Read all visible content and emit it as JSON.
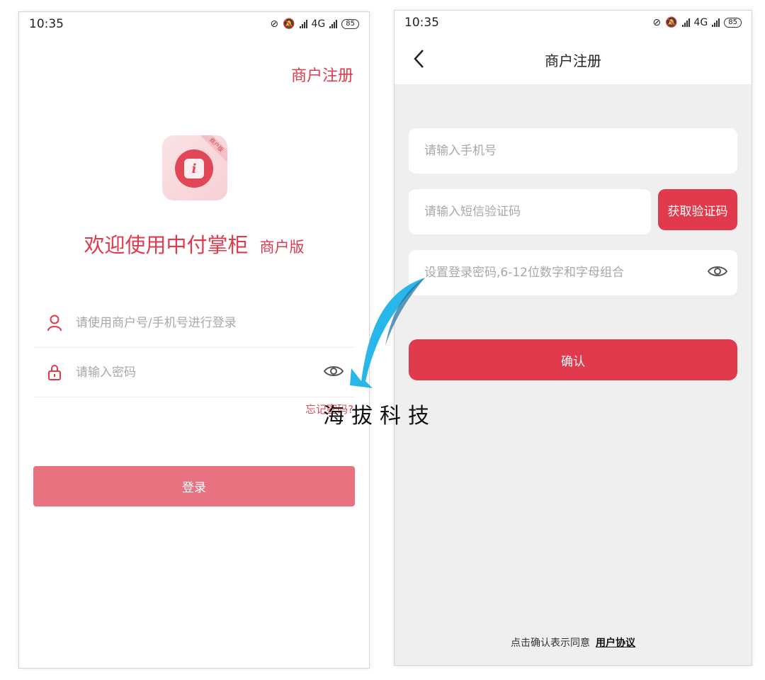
{
  "left_screen": {
    "status": {
      "time": "10:35",
      "network": "4G",
      "battery": "85"
    },
    "register_link": "商户注册",
    "logo": {
      "ribbon": "商户版",
      "glyph": "i"
    },
    "welcome_main": "欢迎使用中付掌柜",
    "welcome_sub": "商户版",
    "username_placeholder": "请使用商户号/手机号进行登录",
    "password_placeholder": "请输入密码",
    "forgot_label": "忘记密码?",
    "login_label": "登录",
    "colors": {
      "accent": "#e03a4c",
      "login_button": "#e8727f"
    }
  },
  "right_screen": {
    "status": {
      "time": "10:35",
      "network": "4G",
      "battery": "85"
    },
    "nav_title": "商户注册",
    "phone_placeholder": "请输入手机号",
    "sms_placeholder": "请输入短信验证码",
    "sms_button": "获取验证码",
    "password_placeholder": "设置登录密码,6-12位数字和字母组合",
    "confirm_label": "确认",
    "agree_text": "点击确认表示同意",
    "agree_link": "用户协议",
    "colors": {
      "accent": "#e03a4c",
      "background": "#efefef"
    }
  },
  "watermark": {
    "text": "海拔科技",
    "color": "#29b6e8"
  }
}
